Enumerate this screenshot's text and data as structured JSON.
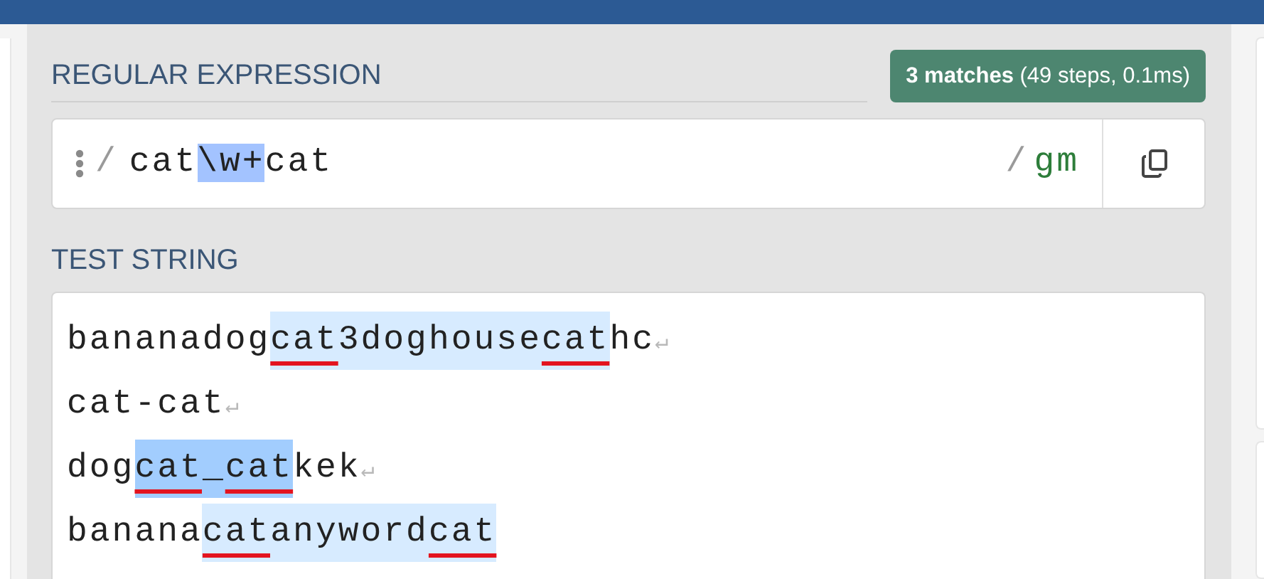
{
  "regex_section": {
    "title": "REGULAR EXPRESSION",
    "match_info": {
      "count": "3 matches",
      "detail": "(49 steps, 0.1ms)"
    },
    "open_delimiter": "/",
    "tokens": [
      {
        "text": "cat",
        "selected": false
      },
      {
        "text": "\\w+",
        "selected": true
      },
      {
        "text": "cat",
        "selected": false
      }
    ],
    "close_delimiter": "/",
    "flags": "gm"
  },
  "test_section": {
    "title": "TEST STRING",
    "lines": [
      {
        "segments": [
          {
            "text": "bananadog",
            "matched": false,
            "selected": false,
            "underline": false
          },
          {
            "text": "cat",
            "matched": true,
            "selected": false,
            "underline": true
          },
          {
            "text": "3doghouse",
            "matched": true,
            "selected": false,
            "underline": false
          },
          {
            "text": "cat",
            "matched": true,
            "selected": false,
            "underline": true
          },
          {
            "text": "hc",
            "matched": false,
            "selected": false,
            "underline": false
          }
        ],
        "end_mark": "↵"
      },
      {
        "segments": [
          {
            "text": "cat-cat",
            "matched": false,
            "selected": false,
            "underline": false
          }
        ],
        "end_mark": "↵"
      },
      {
        "segments": [
          {
            "text": "dog",
            "matched": false,
            "selected": false,
            "underline": false
          },
          {
            "text": "cat",
            "matched": true,
            "selected": true,
            "underline": true
          },
          {
            "text": "_",
            "matched": true,
            "selected": true,
            "underline": false
          },
          {
            "text": "cat",
            "matched": true,
            "selected": true,
            "underline": true
          },
          {
            "text": "kek",
            "matched": false,
            "selected": false,
            "underline": false
          }
        ],
        "end_mark": "↵"
      },
      {
        "segments": [
          {
            "text": "banana",
            "matched": false,
            "selected": false,
            "underline": false
          },
          {
            "text": "cat",
            "matched": true,
            "selected": false,
            "underline": true
          },
          {
            "text": "anyword",
            "matched": true,
            "selected": false,
            "underline": false
          },
          {
            "text": "cat",
            "matched": true,
            "selected": false,
            "underline": true
          }
        ]
      }
    ]
  }
}
